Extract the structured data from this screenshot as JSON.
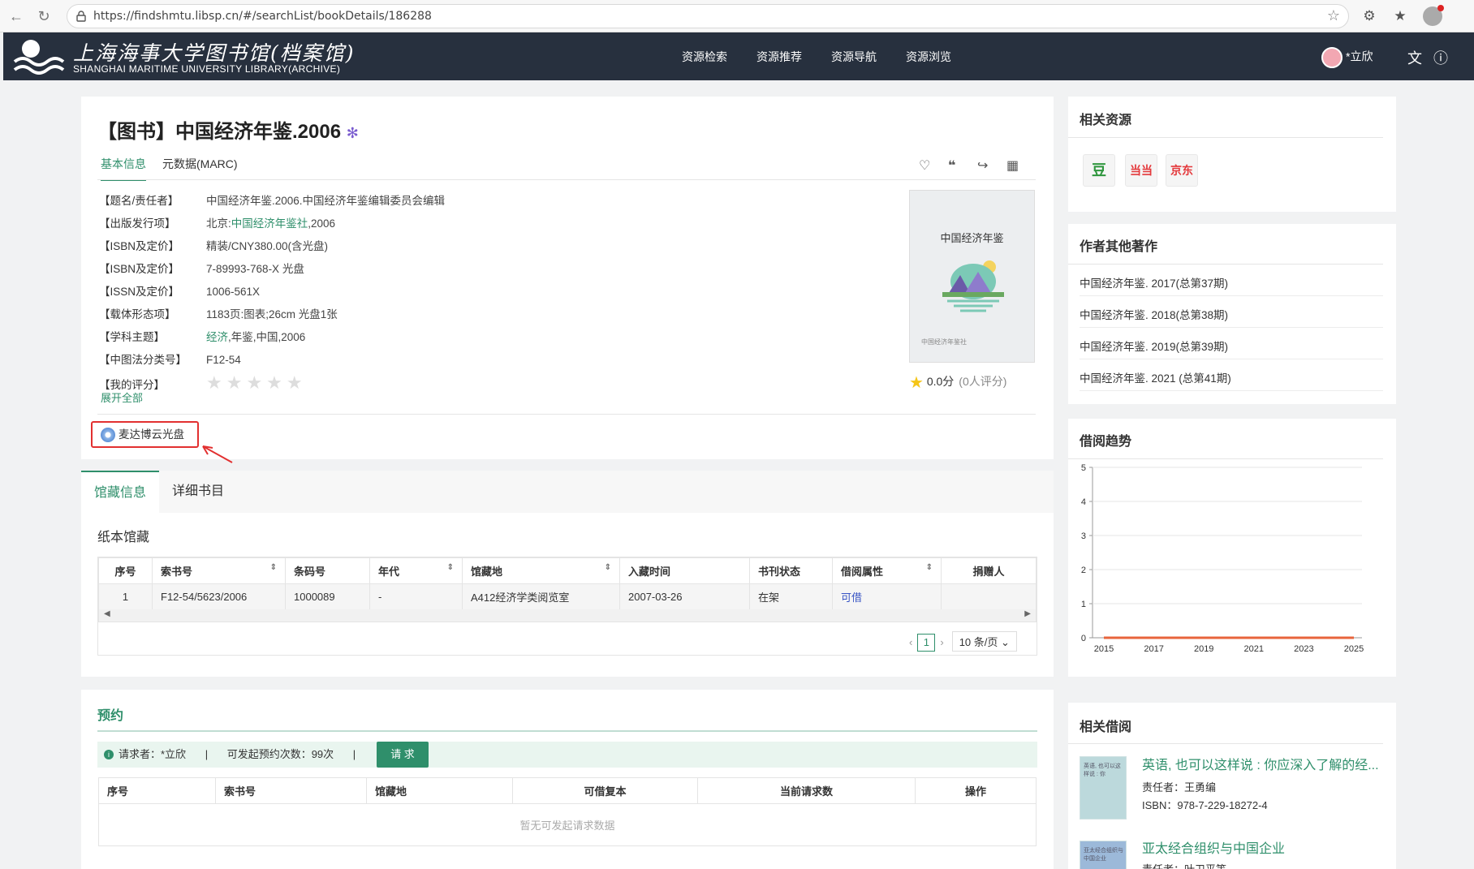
{
  "browser": {
    "url": "https://findshmtu.libsp.cn/#/searchList/bookDetails/186288"
  },
  "header": {
    "logo_cn": "上海海事大学图书馆(档案馆)",
    "logo_en": "SHANGHAI MARITIME UNIVERSITY LIBRARY(ARCHIVE)",
    "nav": [
      "资源检索",
      "资源推荐",
      "资源导航",
      "资源浏览"
    ],
    "user": "*立欣"
  },
  "book": {
    "title": "【图书】中国经济年鉴.2006",
    "tabs": [
      "基本信息",
      "元数据(MARC)"
    ],
    "fields": [
      {
        "k": "【题名/责任者】",
        "v": "中国经济年鉴.2006.中国经济年鉴编辑委员会编辑"
      },
      {
        "k": "【出版发行项】",
        "v1": "北京:",
        "link": "中国经济年鉴社",
        "v2": ",2006"
      },
      {
        "k": "【ISBN及定价】",
        "v": "精装/CNY380.00(含光盘)"
      },
      {
        "k": "【ISBN及定价】",
        "v": "7-89993-768-X 光盘"
      },
      {
        "k": "【ISSN及定价】",
        "v": "1006-561X"
      },
      {
        "k": "【载体形态项】",
        "v": "1183页:图表;26cm 光盘1张"
      },
      {
        "k": "【学科主题】",
        "link": "经济",
        "v2": ",年鉴,中国,2006"
      },
      {
        "k": "【中图法分类号】",
        "v": "F12-54"
      },
      {
        "k": "【我的评分】"
      }
    ],
    "stars": "★★★★★",
    "expand": "展开全部",
    "cover_title": "中国经济年鉴",
    "cover_pub": "中国经济年鉴社",
    "rating": "0.0分",
    "rating_count": "(0人评分)",
    "cd_label": "麦达博云光盘"
  },
  "holdings": {
    "tabs": [
      "馆藏信息",
      "详细书目"
    ],
    "section": "纸本馆藏",
    "columns": [
      "序号",
      "索书号",
      "条码号",
      "年代",
      "馆藏地",
      "入藏时间",
      "书刊状态",
      "借阅属性",
      "捐赠人"
    ],
    "rows": [
      [
        "1",
        "F12-54/5623/2006",
        "1000089",
        "-",
        "A412经济学类阅览室",
        "2007-03-26",
        "在架",
        "可借",
        ""
      ]
    ],
    "page": "1",
    "page_size": "10 条/页"
  },
  "reserve": {
    "title": "预约",
    "requester": "请求者：*立欣",
    "sep": "|",
    "times": "可发起预约次数：99次",
    "button": "请 求",
    "columns": [
      "序号",
      "索书号",
      "馆藏地",
      "可借复本",
      "当前请求数",
      "操作"
    ],
    "empty": "暂无可发起请求数据"
  },
  "sidebar": {
    "related_res_title": "相关资源",
    "shops": [
      {
        "label": "豆",
        "color": "#2e963d"
      },
      {
        "label": "当当",
        "color": "#e4393c"
      },
      {
        "label": "京东",
        "color": "#e4393c"
      }
    ],
    "other_title": "作者其他著作",
    "other_items": [
      "中国经济年鉴. 2017(总第37期)",
      "中国经济年鉴. 2018(总第38期)",
      "中国经济年鉴. 2019(总第39期)",
      "中国经济年鉴. 2021 (总第41期)"
    ],
    "trend_title": "借阅趋势",
    "related_borrow_title": "相关借阅",
    "related_books": [
      {
        "title": "英语, 也可以这样说 : 你应深入了解的经...",
        "author": "责任者：王勇编",
        "isbn": "ISBN：978-7-229-18272-4",
        "thumb": "英语, 也可以这样说 : 你"
      },
      {
        "title": "亚太经合组织与中国企业",
        "author": "责任者：叶卫平等",
        "isbn": "",
        "thumb": "亚太经合组织与中国企业"
      }
    ]
  },
  "chart_data": {
    "type": "line",
    "title": "",
    "x": [
      2015,
      2016,
      2017,
      2018,
      2019,
      2020,
      2021,
      2022,
      2023,
      2024,
      2025
    ],
    "xticks": [
      "2015",
      "2017",
      "2019",
      "2021",
      "2023",
      "2025"
    ],
    "series": [
      {
        "values": [
          0,
          0,
          0,
          0,
          0,
          0,
          0,
          0,
          0,
          0,
          0
        ],
        "color": "#e8643c"
      }
    ],
    "ylim": [
      0,
      5
    ],
    "yticks": [
      "0",
      "1",
      "2",
      "3",
      "4",
      "5"
    ],
    "grid": true
  }
}
